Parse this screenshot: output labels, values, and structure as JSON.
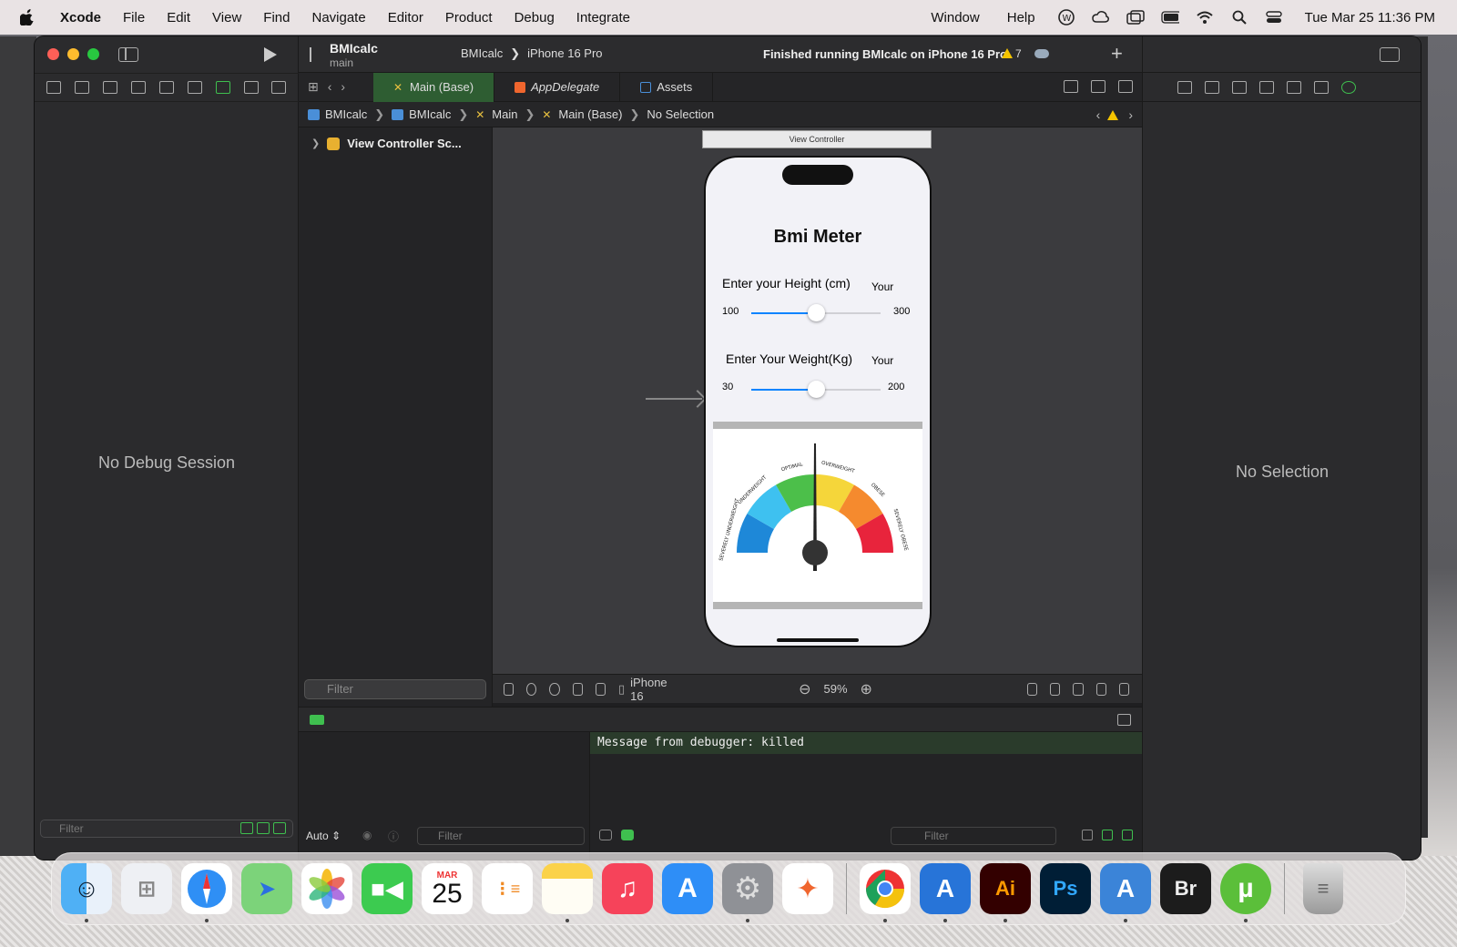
{
  "menubar": {
    "app_name": "Xcode",
    "items": [
      "File",
      "Edit",
      "View",
      "Find",
      "Navigate",
      "Editor",
      "Product",
      "Debug",
      "Integrate"
    ],
    "right_items": [
      "Window",
      "Help"
    ],
    "clock": "Tue Mar 25  11:36 PM"
  },
  "toolbar": {
    "project_name": "BMIcalc",
    "branch": "main",
    "scheme": "BMIcalc",
    "destination": "iPhone 16 Pro",
    "status": "Finished running BMIcalc on iPhone 16 Pro",
    "warning_count": "7"
  },
  "tabs": [
    {
      "label": "Main (Base)",
      "active": true
    },
    {
      "label": "AppDelegate",
      "active": false
    },
    {
      "label": "Assets",
      "active": false
    }
  ],
  "jumpbar": [
    "BMIcalc",
    "BMIcalc",
    "Main",
    "Main (Base)",
    "No Selection"
  ],
  "outline": {
    "item": "View Controller Sc...",
    "filter_placeholder": "Filter"
  },
  "canvas": {
    "scene_label": "View Controller",
    "device": "iPhone 16",
    "zoom": "59%"
  },
  "phone": {
    "title": "Bmi Meter",
    "height_label": "Enter your Height (cm)",
    "height_your": "Your",
    "height_min": "100",
    "height_max": "300",
    "height_value_fraction": 0.5,
    "weight_label": "Enter Your Weight(Kg)",
    "weight_your": "Your",
    "weight_min": "30",
    "weight_max": "200",
    "weight_value_fraction": 0.5,
    "gauge_labels": [
      "SEVERELY UNDERWEIGHT",
      "UNDERWEIGHT",
      "OPTIMAL",
      "OVERWEIGHT",
      "OBESE",
      "SEVERELY OBESE"
    ],
    "gauge_colors": [
      "#1e88d8",
      "#3ec1f0",
      "#4cbf4a",
      "#f5d63a",
      "#f58a2e",
      "#e8243c"
    ]
  },
  "navigator": {
    "empty_text": "No Debug Session",
    "filter_placeholder": "Filter"
  },
  "debug": {
    "console_message": "Message from debugger: killed",
    "auto_label": "Auto ⇕",
    "variables_filter": "Filter",
    "console_filter": "Filter"
  },
  "inspector": {
    "empty_text": "No Selection"
  },
  "dock": {
    "calendar_month": "MAR",
    "calendar_day": "25",
    "apps": [
      "Finder",
      "Launchpad",
      "Safari",
      "Maps",
      "Photos",
      "FaceTime",
      "Calendar",
      "Reminders",
      "Notes",
      "Music",
      "App Store",
      "System Settings",
      "Swift Playgrounds",
      "Chrome",
      "Xcode",
      "Ai",
      "Ps",
      "Instruments",
      "Br",
      "uTorrent",
      "Trash"
    ],
    "illustrator_label": "Ai",
    "photoshop_label": "Ps",
    "bridge_label": "Br"
  }
}
